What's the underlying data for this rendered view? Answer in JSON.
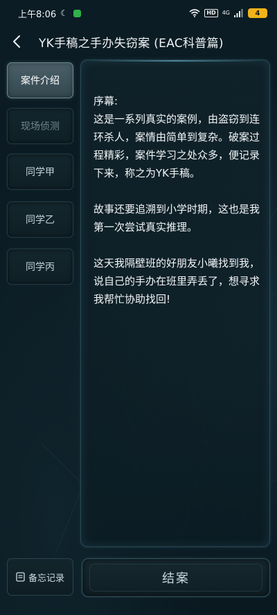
{
  "status_bar": {
    "time": "上午8:06",
    "hd": "HD",
    "network": "4G",
    "battery": "4"
  },
  "header": {
    "title": "YK手稿之手办失窃案 (EAC科普篇)"
  },
  "nav": {
    "items": [
      {
        "label": "案件介绍",
        "state": "active"
      },
      {
        "label": "现场侦测",
        "state": "dim"
      },
      {
        "label": "同学甲",
        "state": "normal"
      },
      {
        "label": "同学乙",
        "state": "normal"
      },
      {
        "label": "同学丙",
        "state": "normal"
      }
    ]
  },
  "content": {
    "paragraphs": [
      "序幕:\n这是一系列真实的案例，由盗窃到连环杀人，案情由简单到复杂。破案过程精彩，案件学习之处众多，便记录下来，称之为YK手稿。",
      "故事还要追溯到小学时期，这也是我第一次尝试真实推理。",
      "这天我隔壁班的好朋友小曦找到我，说自己的手办在班里弄丢了，想寻求我帮忙协助找回!"
    ]
  },
  "bottom": {
    "memo_label": "备忘记录",
    "close_case_label": "结案"
  }
}
